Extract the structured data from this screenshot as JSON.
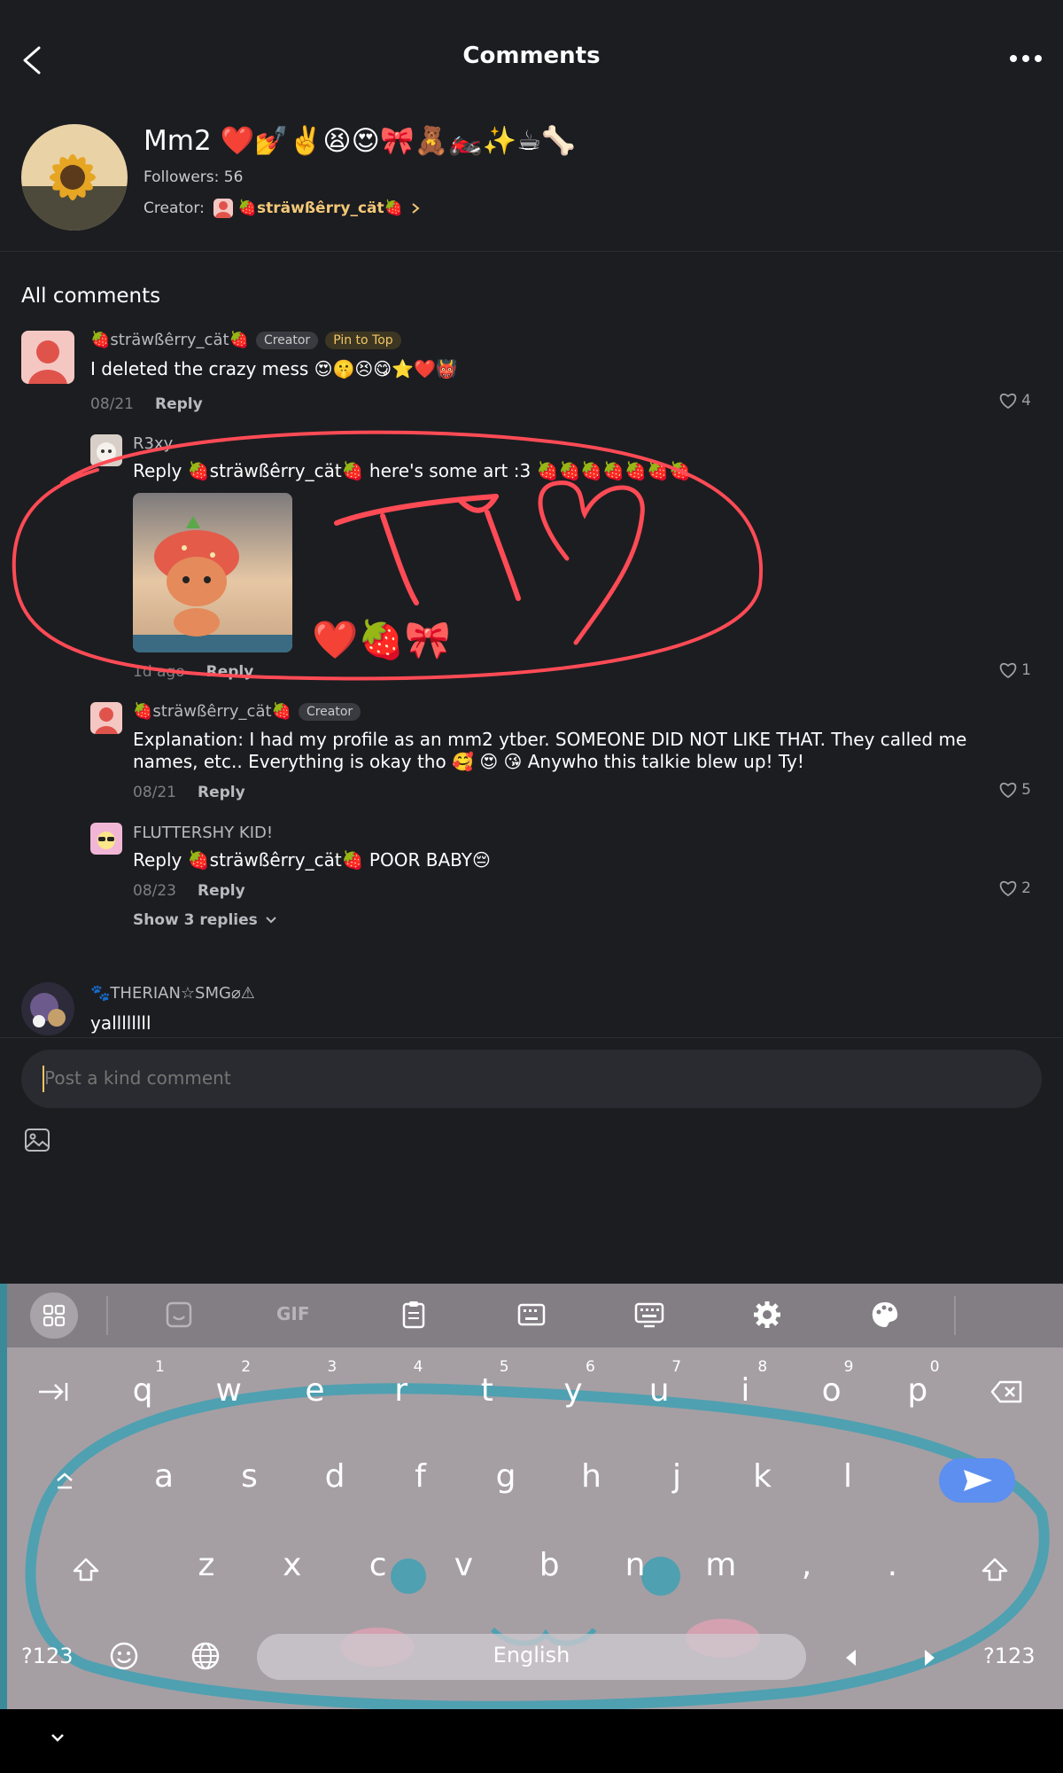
{
  "header": {
    "title": "Comments"
  },
  "talkie": {
    "name": "Mm2 ❤️💅✌️😫😍🎀🧸🏍️✨☕🦴",
    "followers": "Followers: 56",
    "creator_label": "Creator:",
    "creator_name": "🍓sträwßêrry_cät🍓"
  },
  "section_title": "All comments",
  "comments": [
    {
      "user": "🍓sträwßêrry_cät🍓",
      "badge_creator": "Creator",
      "badge_pin": "Pin to Top",
      "text": "I deleted the crazy mess 😍🤫😣😋⭐❤️👹",
      "date": "08/21",
      "reply": "Reply",
      "likes": "4"
    },
    {
      "user": "R3xy",
      "text": "Reply 🍓sträwßêrry_cät🍓 here's some art :3 🍓🍓🍓🍓🍓🍓🍓",
      "date": "1d ago",
      "reply": "Reply",
      "likes": "1",
      "drawing_text": "TY",
      "sticker": "❤️🍓🎀"
    },
    {
      "user": "🍓sträwßêrry_cät🍓",
      "badge_creator": "Creator",
      "text": "Explanation: I had my profile as an mm2 ytber. SOMEONE DID NOT LIKE THAT. They called me names, etc.. Everything is okay tho 🥰 😍 😘 Anywho this talkie blew up! Ty!",
      "date": "08/21",
      "reply": "Reply",
      "likes": "5"
    },
    {
      "user": "FLUTTERSHY KID!",
      "text": "Reply 🍓sträwßêrry_cät🍓 POOR BABY😔",
      "date": "08/23",
      "reply": "Reply",
      "likes": "2",
      "show_replies": "Show 3 replies"
    },
    {
      "user": "🐾THERIAN☆SMG⌀⚠",
      "text": "yallllllll"
    }
  ],
  "input": {
    "placeholder": "Post a kind comment"
  },
  "keyboard": {
    "row1": [
      "q",
      "w",
      "e",
      "r",
      "t",
      "y",
      "u",
      "i",
      "o",
      "p"
    ],
    "row1_nums": [
      "1",
      "2",
      "3",
      "4",
      "5",
      "6",
      "7",
      "8",
      "9",
      "0"
    ],
    "row2": [
      "a",
      "s",
      "d",
      "f",
      "g",
      "h",
      "j",
      "k",
      "l"
    ],
    "row3": [
      "z",
      "x",
      "c",
      "v",
      "b",
      "n",
      "m",
      ",",
      "."
    ],
    "sym_left": "?123",
    "sym_right": "?123",
    "space": "English",
    "gif": "GIF"
  },
  "icons": [
    "back-arrow-icon",
    "more-icon",
    "heart-icon",
    "image-icon",
    "apps-grid-icon",
    "sticker-icon",
    "clipboard-icon",
    "keyboard-icon",
    "settings-icon",
    "palette-icon",
    "tab-icon",
    "backspace-icon",
    "shift-icon",
    "send-icon",
    "emoji-icon",
    "globe-icon",
    "chevron-down-icon"
  ],
  "colors": {
    "background": "#1c1d21",
    "pin": "#f2c763",
    "annotation": "#ff4b55",
    "send": "#5c8ff0"
  }
}
